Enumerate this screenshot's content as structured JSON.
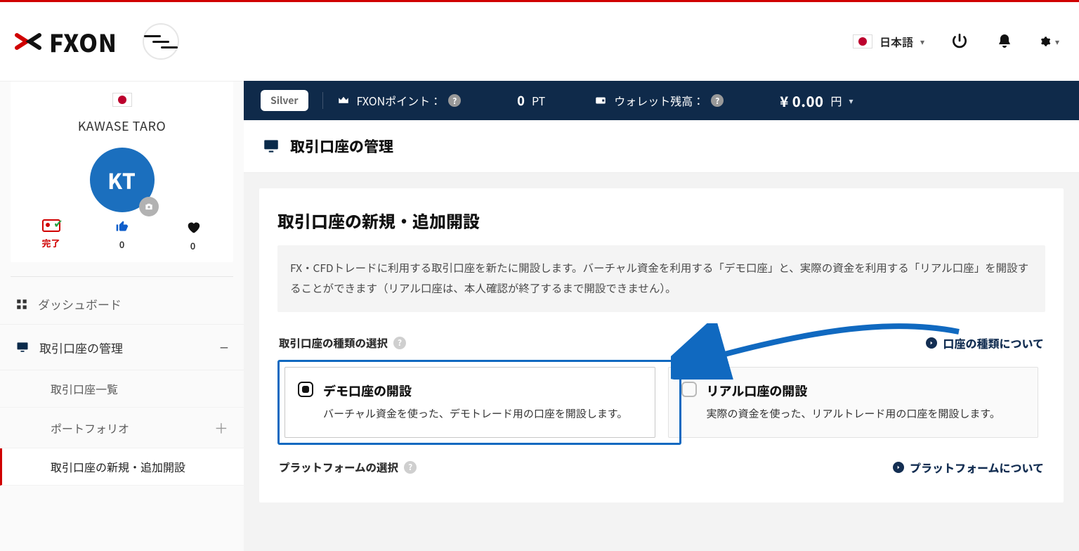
{
  "brand": "FXON",
  "header": {
    "language_label": "日本語"
  },
  "status": {
    "tier": "Silver",
    "points_label": "FXONポイント：",
    "points_value": "0",
    "points_unit": "PT",
    "wallet_label": "ウォレット残高：",
    "wallet_value": "¥ 0.00",
    "wallet_unit": "円"
  },
  "profile": {
    "name": "KAWASE TARO",
    "initials": "KT",
    "stat_done": "完了",
    "likes": "0",
    "favs": "0"
  },
  "menu": {
    "dashboard": "ダッシュボード",
    "accounts": "取引口座の管理",
    "sub_list": "取引口座一覧",
    "sub_portfolio": "ポートフォリオ",
    "sub_open": "取引口座の新規・追加開設"
  },
  "page": {
    "title": "取引口座の管理",
    "section_title": "取引口座の新規・追加開設",
    "notice": "FX・CFDトレードに利用する取引口座を新たに開設します。バーチャル資金を利用する「デモ口座」と、実際の資金を利用する「リアル口座」を開設することができます（リアル口座は、本人確認が終了するまで開設できません）。",
    "type": {
      "label": "取引口座の種類の選択",
      "link": "口座の種類について",
      "options": [
        {
          "title": "デモ口座の開設",
          "desc": "バーチャル資金を使った、デモトレード用の口座を開設します。"
        },
        {
          "title": "リアル口座の開設",
          "desc": "実際の資金を使った、リアルトレード用の口座を開設します。"
        }
      ]
    },
    "platform": {
      "label": "プラットフォームの選択",
      "link": "プラットフォームについて"
    }
  }
}
